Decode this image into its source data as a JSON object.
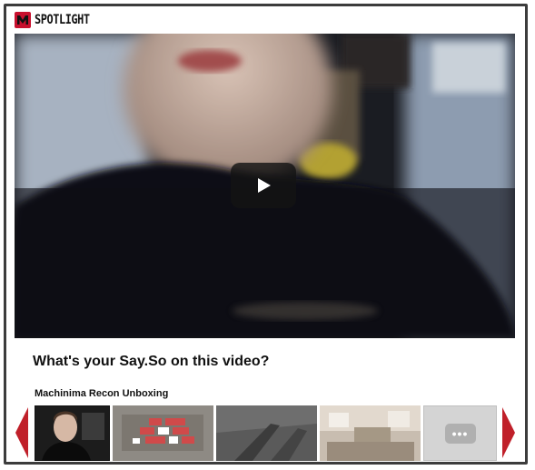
{
  "header": {
    "logo_icon": "machinima-m-logo-icon",
    "brand": "SPOTLIGHT"
  },
  "video": {
    "play_icon": "play-icon"
  },
  "question": "What's your Say.So on this video?",
  "playlist": {
    "title": "Machinima Recon Unboxing",
    "prev_icon": "chevron-left-icon",
    "next_icon": "chevron-right-icon",
    "more_icon": "more-dots-icon",
    "more_label": "•••",
    "thumbnails": [
      "thumb-1",
      "thumb-2",
      "thumb-3",
      "thumb-4"
    ]
  },
  "colors": {
    "accent": "#c8102e",
    "frame": "#3c3c3c"
  }
}
